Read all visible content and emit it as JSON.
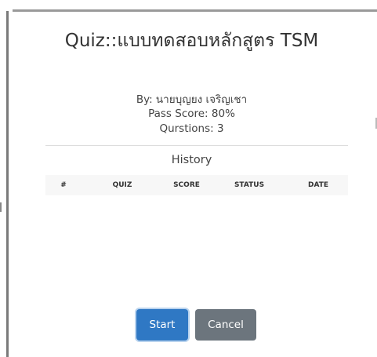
{
  "dialog": {
    "title": "Quiz::แบบทดสอบหลักสูตร TSM",
    "by": "By: นายบุญยง เจริญเชา",
    "pass_score": "Pass Score: 80%",
    "questions": "Qurstions: 3"
  },
  "history": {
    "title": "History",
    "columns": [
      "#",
      "QUIZ",
      "SCORE",
      "STATUS",
      "DATE"
    ],
    "rows": []
  },
  "buttons": {
    "start_label": "Start",
    "cancel_label": "Cancel"
  },
  "colors": {
    "start_button": "#2f78c4",
    "cancel_button": "#6c757d",
    "title_text": "#333333"
  }
}
